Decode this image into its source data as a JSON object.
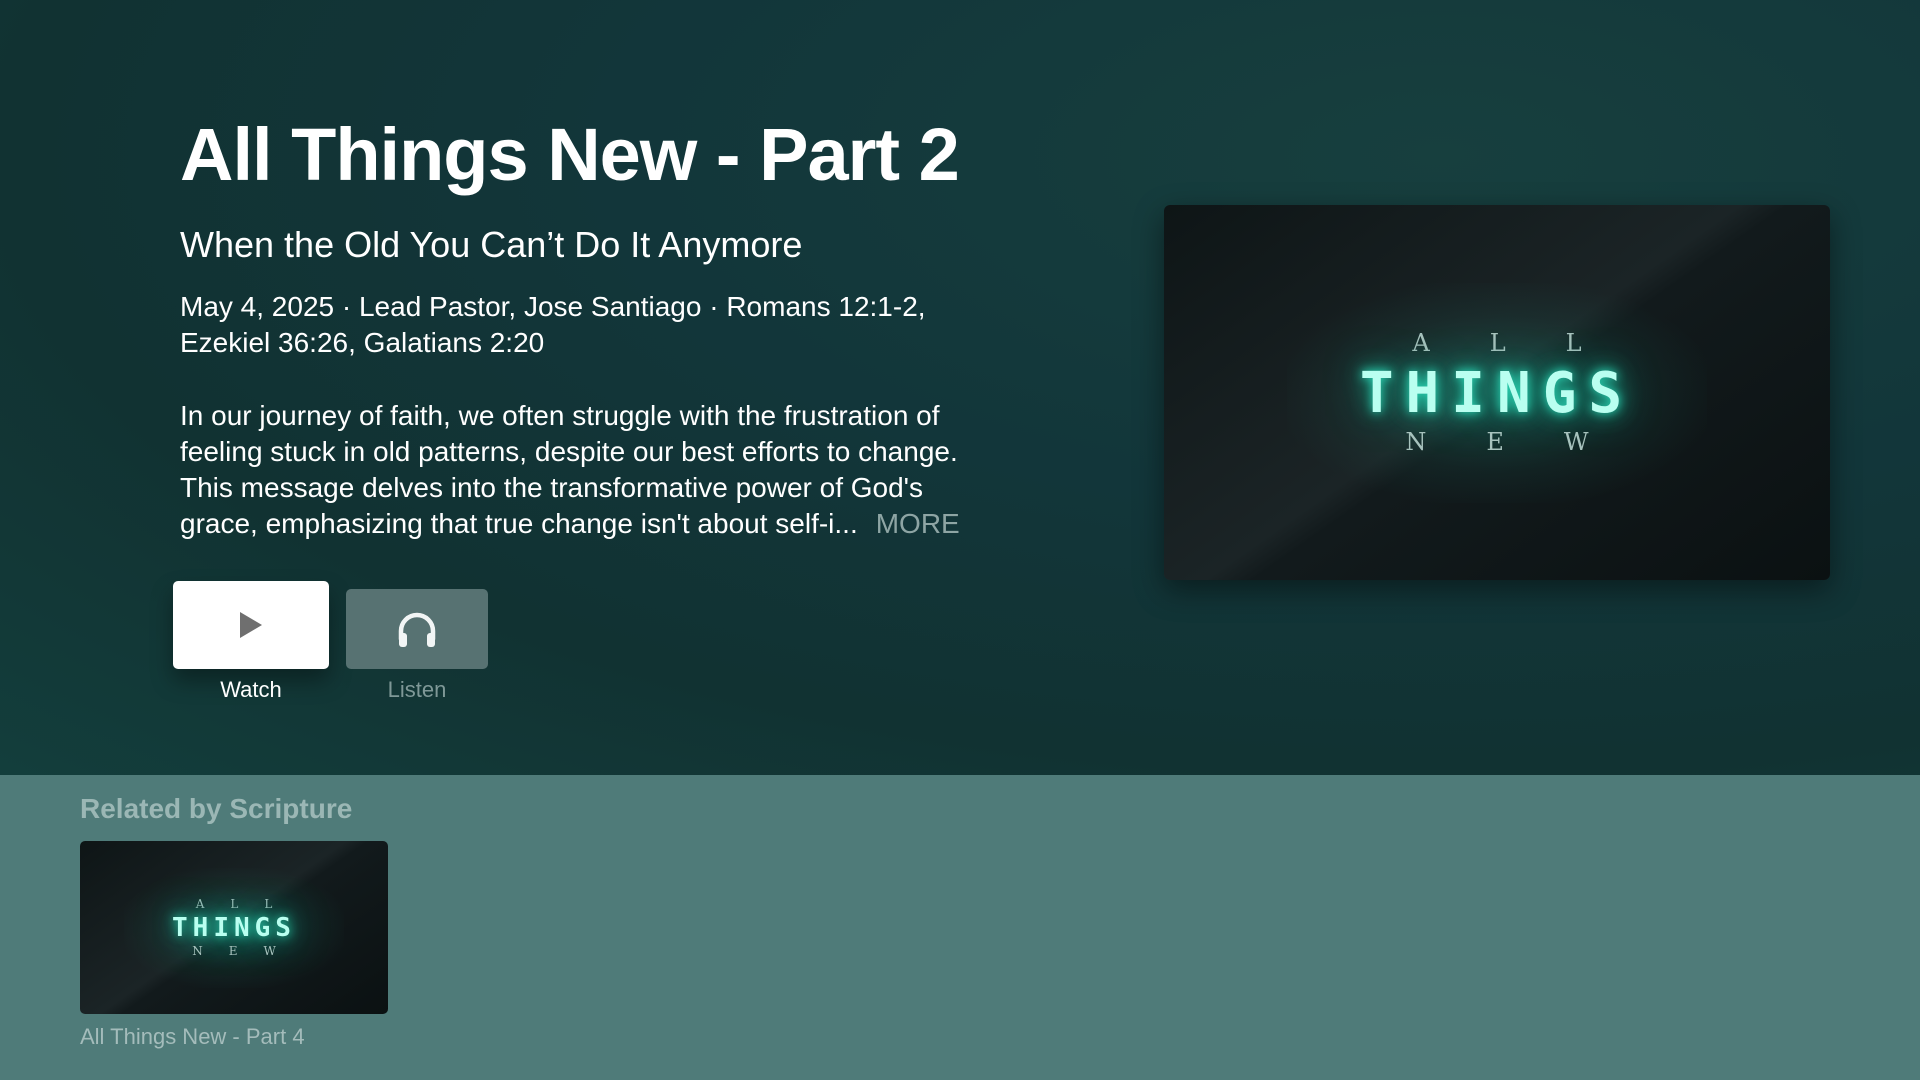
{
  "episode": {
    "title": "All Things New - Part 2",
    "subtitle": "When the Old You Can’t Do It Anymore",
    "meta": "May 4, 2025 · Lead Pastor, Jose Santiago · Romans 12:1-2, Ezekiel 36:26, Galatians 2:20",
    "description": "In our journey of faith, we often struggle with the frustration of feeling stuck in old patterns, despite our best efforts to change. This message delves into the transformative power of God's grace, emphasizing that true change isn't about self-i...",
    "more_label": "MORE"
  },
  "actions": {
    "watch": {
      "label": "Watch",
      "icon": "play-icon"
    },
    "listen": {
      "label": "Listen",
      "icon": "headphones-icon"
    }
  },
  "artwork": {
    "top_word": "ALL",
    "main_word": "THINGS",
    "bottom_word": "NEW",
    "glow_color": "#2de0bd"
  },
  "related": {
    "heading": "Related by Scripture",
    "items": [
      {
        "title": "All Things New - Part 4",
        "top_word": "ALL",
        "main_word": "THINGS",
        "bottom_word": "NEW"
      }
    ]
  },
  "colors": {
    "hero_background": "#12363a",
    "related_background": "#4f7b79",
    "more_text": "#8ea5a4"
  }
}
